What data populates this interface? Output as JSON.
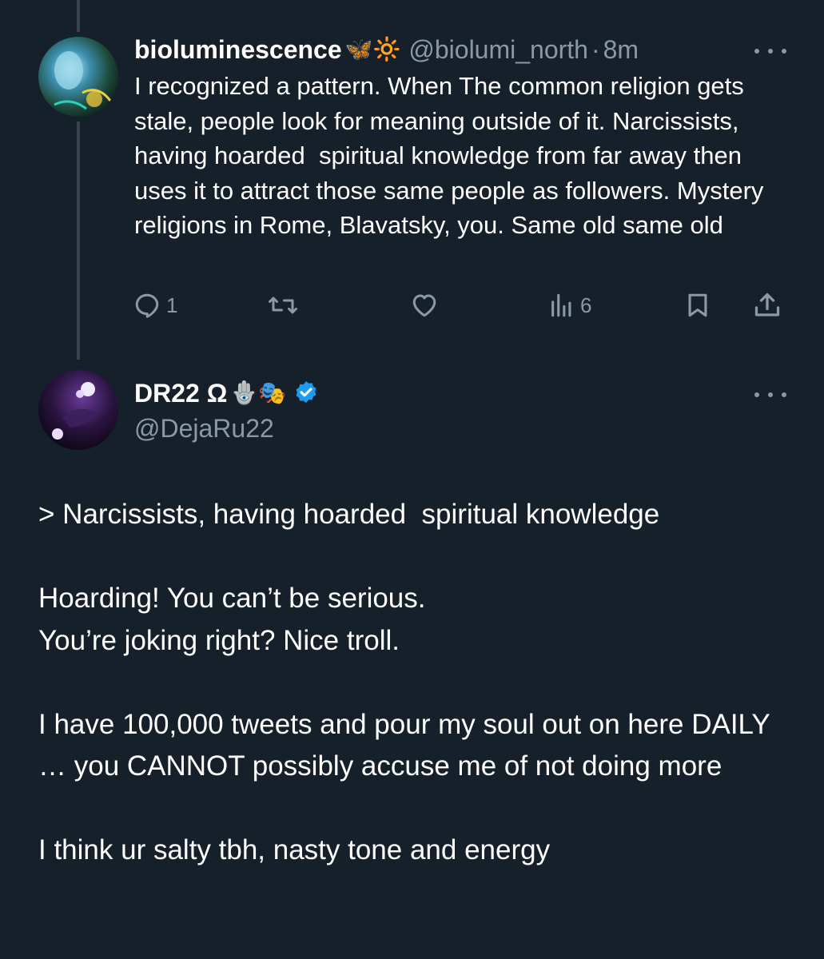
{
  "reply_tweet": {
    "display_name": "bioluminescence",
    "name_emojis": "🦋🔆",
    "handle": "@biolumi_north",
    "separator": "·",
    "time": "8m",
    "text": "I recognized a pattern. When The common religion gets stale, people look for meaning outside of it. Narcissists, having hoarded  spiritual knowledge from far away then uses it to attract those same people as followers. Mystery religions in Rome, Blavatsky, you. Same old same old",
    "actions": {
      "reply_count": "1",
      "views_count": "6"
    },
    "icons": [
      "more-icon",
      "reply-icon",
      "retweet-icon",
      "like-icon",
      "views-icon",
      "bookmark-icon",
      "share-icon"
    ]
  },
  "main_tweet": {
    "display_name": "DR22 Ω",
    "name_emojis": "🪬🎭",
    "verified": true,
    "handle": "@DejaRu22",
    "paragraphs": [
      "> Narcissists, having hoarded  spiritual knowledge",
      "Hoarding! You can’t be serious.\nYou’re joking right? Nice troll.",
      "I have 100,000 tweets and pour my soul out on here DAILY … you CANNOT possibly accuse me of not doing more",
      "I think ur salty tbh, nasty tone and energy"
    ]
  },
  "colors": {
    "background": "#15202b",
    "secondary_text": "#8b98a5",
    "thread_line": "#38444d",
    "verified_blue": "#1d9bf0"
  }
}
